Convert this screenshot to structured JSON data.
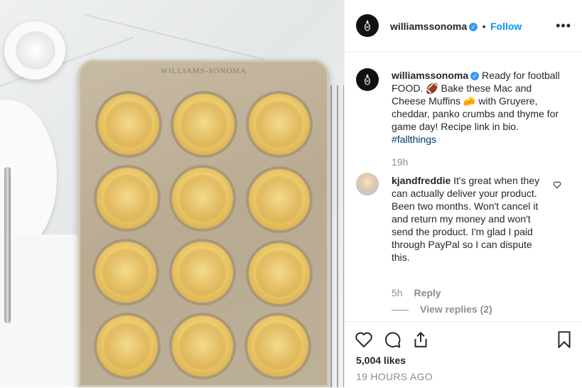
{
  "photo": {
    "brand_stamp": "WILLIAMS-SONOMA",
    "alt": ""
  },
  "header": {
    "username": "williamssonoma",
    "separator": "•",
    "follow_label": "Follow",
    "more_icon": "more-horizontal-icon"
  },
  "caption": {
    "username": "williamssonoma",
    "text": "Ready for football FOOD. 🏈 Bake these Mac and Cheese Muffins 🧀 with Gruyere, cheddar, panko crumbs and thyme for game day! Recipe link in bio.",
    "hashtag": "#fallthings",
    "age": "19h"
  },
  "comment": {
    "username": "kjandfreddie",
    "text": "It's great when they can actually deliver your product. Been two months. Won't cancel it and return my money and won't send the product. I'm glad I paid through PayPal so I can dispute this.",
    "age": "5h",
    "reply_label": "Reply",
    "view_replies": "View replies (2)"
  },
  "actions": {
    "likes": "5,004 likes",
    "timestamp": "19 HOURS AGO"
  },
  "colors": {
    "accent": "#0095f6",
    "verified": "#3897f0",
    "muted": "#8e8e8e",
    "text": "#262626"
  }
}
